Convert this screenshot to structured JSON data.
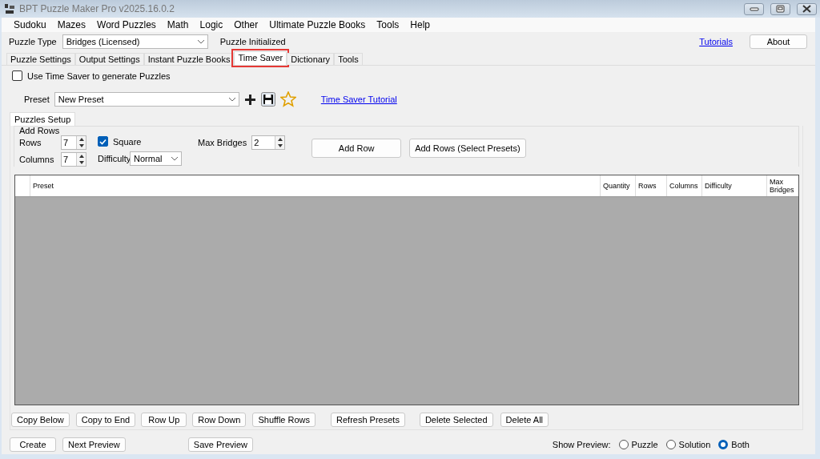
{
  "window": {
    "title": "BPT Puzzle Maker Pro v2025.16.0.2"
  },
  "menu": [
    "Sudoku",
    "Mazes",
    "Word Puzzles",
    "Math",
    "Logic",
    "Other",
    "Ultimate Puzzle Books",
    "Tools",
    "Help"
  ],
  "puzzle_type": {
    "label": "Puzzle Type",
    "value": "Bridges (Licensed)",
    "status": "Puzzle Initialized"
  },
  "tutorials_link": "Tutorials",
  "about_button": "About",
  "tabs": [
    {
      "label": "Puzzle Settings",
      "selected": false,
      "highlighted": false
    },
    {
      "label": "Output Settings",
      "selected": false,
      "highlighted": false
    },
    {
      "label": "Instant Puzzle Books",
      "selected": false,
      "highlighted": false
    },
    {
      "label": "Time Saver",
      "selected": true,
      "highlighted": true
    },
    {
      "label": "Dictionary",
      "selected": false,
      "highlighted": false
    },
    {
      "label": "Tools",
      "selected": false,
      "highlighted": false
    }
  ],
  "use_time_saver": {
    "label": "Use Time Saver to generate Puzzles",
    "checked": false
  },
  "preset": {
    "label": "Preset",
    "value": "New Preset",
    "tutorial_link": "Time Saver Tutorial"
  },
  "sub_tabs": [
    {
      "label": "Puzzles Setup",
      "selected": true
    }
  ],
  "add_rows": {
    "title": "Add Rows",
    "rows": {
      "label": "Rows",
      "value": "7"
    },
    "columns": {
      "label": "Columns",
      "value": "7"
    },
    "square": {
      "label": "Square",
      "checked": true
    },
    "difficulty": {
      "label": "Difficulty",
      "value": "Normal"
    },
    "max_bridges": {
      "label": "Max Bridges",
      "value": "2"
    },
    "buttons": [
      "Add Row",
      "Add Rows (Select Presets)"
    ]
  },
  "table": {
    "columns": [
      "Preset",
      "Quantity",
      "Rows",
      "Columns",
      "Difficulty",
      "Max Bridges"
    ]
  },
  "row_buttons": [
    "Copy Below",
    "Copy to End",
    "Row Up",
    "Row Down",
    "Shuffle Rows",
    "Refresh Presets",
    "Delete Selected",
    "Delete All"
  ],
  "bottom_buttons": [
    "Create",
    "Next Preview",
    "Save Preview"
  ],
  "show_preview": {
    "label": "Show Preview:",
    "options": [
      {
        "label": "Puzzle",
        "selected": false
      },
      {
        "label": "Solution",
        "selected": false
      },
      {
        "label": "Both",
        "selected": true
      }
    ]
  }
}
